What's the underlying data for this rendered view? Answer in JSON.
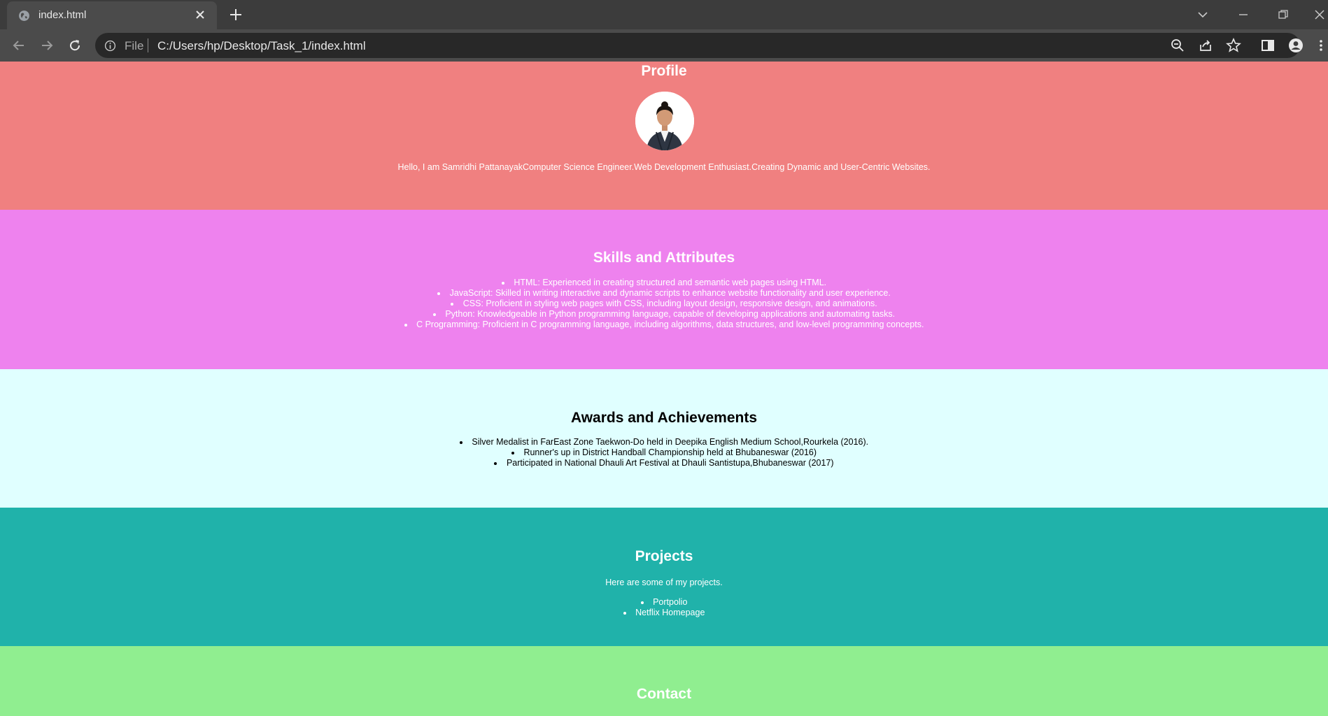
{
  "browser": {
    "tab_title": "index.html",
    "scheme_label": "File",
    "url": "C:/Users/hp/Desktop/Task_1/index.html"
  },
  "profile": {
    "heading": "Profile",
    "intro": "Hello, I am Samridhi PattanayakComputer Science Engineer.Web Development Enthusiast.Creating Dynamic and User-Centric Websites."
  },
  "skills": {
    "heading": "Skills and Attributes",
    "items": [
      "HTML: Experienced in creating structured and semantic web pages using HTML.",
      "JavaScript: Skilled in writing interactive and dynamic scripts to enhance website functionality and user experience.",
      "CSS: Proficient in styling web pages with CSS, including layout design, responsive design, and animations.",
      "Python: Knowledgeable in Python programming language, capable of developing applications and automating tasks.",
      "C Programming: Proficient in C programming language, including algorithms, data structures, and low-level programming concepts."
    ]
  },
  "awards": {
    "heading": "Awards and Achievements",
    "items": [
      "Silver Medalist in FarEast Zone Taekwon-Do held in Deepika English Medium School,Rourkela (2016).",
      "Runner's up in District Handball Championship held at Bhubaneswar (2016)",
      "Participated in National Dhauli Art Festival at Dhauli Santistupa,Bhubaneswar (2017)"
    ]
  },
  "projects": {
    "heading": "Projects",
    "intro": "Here are some of my projects.",
    "items": [
      "Portpolio",
      "Netflix Homepage"
    ]
  },
  "contact": {
    "heading": "Contact"
  },
  "colors": {
    "profile_bg": "#f08080",
    "skills_bg": "#ee82ee",
    "awards_bg": "#e0ffff",
    "projects_bg": "#20b2aa",
    "contact_bg": "#90ee90"
  }
}
